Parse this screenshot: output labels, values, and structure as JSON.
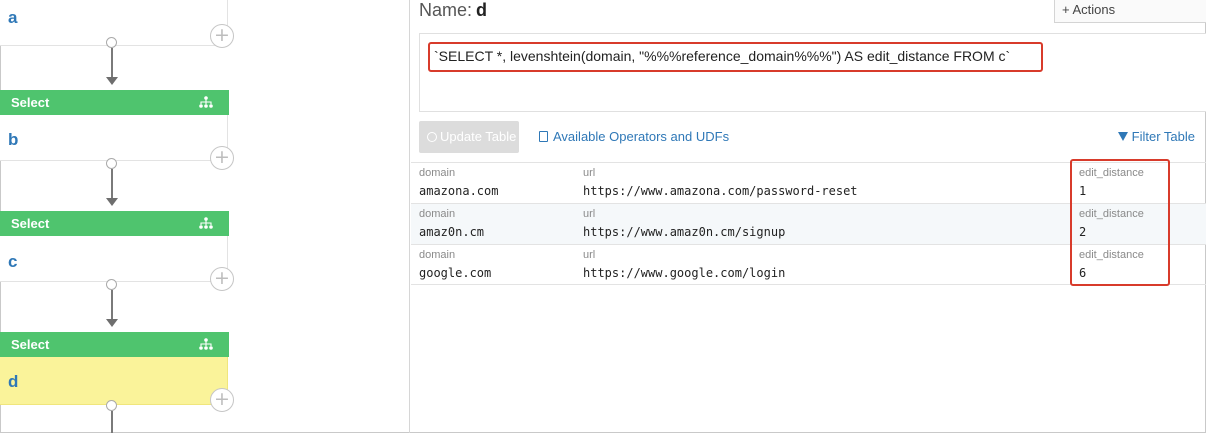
{
  "pipeline": {
    "nodes": [
      {
        "label": "a"
      },
      {
        "label": "b"
      },
      {
        "label": "c"
      },
      {
        "label": "d"
      }
    ],
    "steps": [
      {
        "label": "Select",
        "icon": "tree-icon"
      },
      {
        "label": "Select",
        "icon": "tree-icon"
      },
      {
        "label": "Select",
        "icon": "tree-icon"
      }
    ],
    "add_icon": "+"
  },
  "panel": {
    "name_label": "Name:",
    "name_value": "d",
    "actions_label": "+ Actions",
    "query": "`SELECT *, levenshtein(domain, \"%%%reference_domain%%%\") AS edit_distance FROM c`",
    "update_button": "Update Table",
    "operators_link": "Available Operators and UDFs",
    "filter_link": "Filter Table"
  },
  "table": {
    "columns": [
      "domain",
      "url",
      "edit_distance"
    ],
    "rows": [
      {
        "domain": "amazona.com",
        "url": "https://www.amazona.com/password-reset",
        "edit_distance": "1"
      },
      {
        "domain": "amaz0n.cm",
        "url": "https://www.amaz0n.cm/signup",
        "edit_distance": "2"
      },
      {
        "domain": "google.com",
        "url": "https://www.google.com/login",
        "edit_distance": "6"
      }
    ]
  },
  "colors": {
    "step_green": "#4fc46e",
    "active_node": "#faf39a",
    "link_blue": "#2f78b7",
    "highlight_red": "#d83b2b"
  }
}
